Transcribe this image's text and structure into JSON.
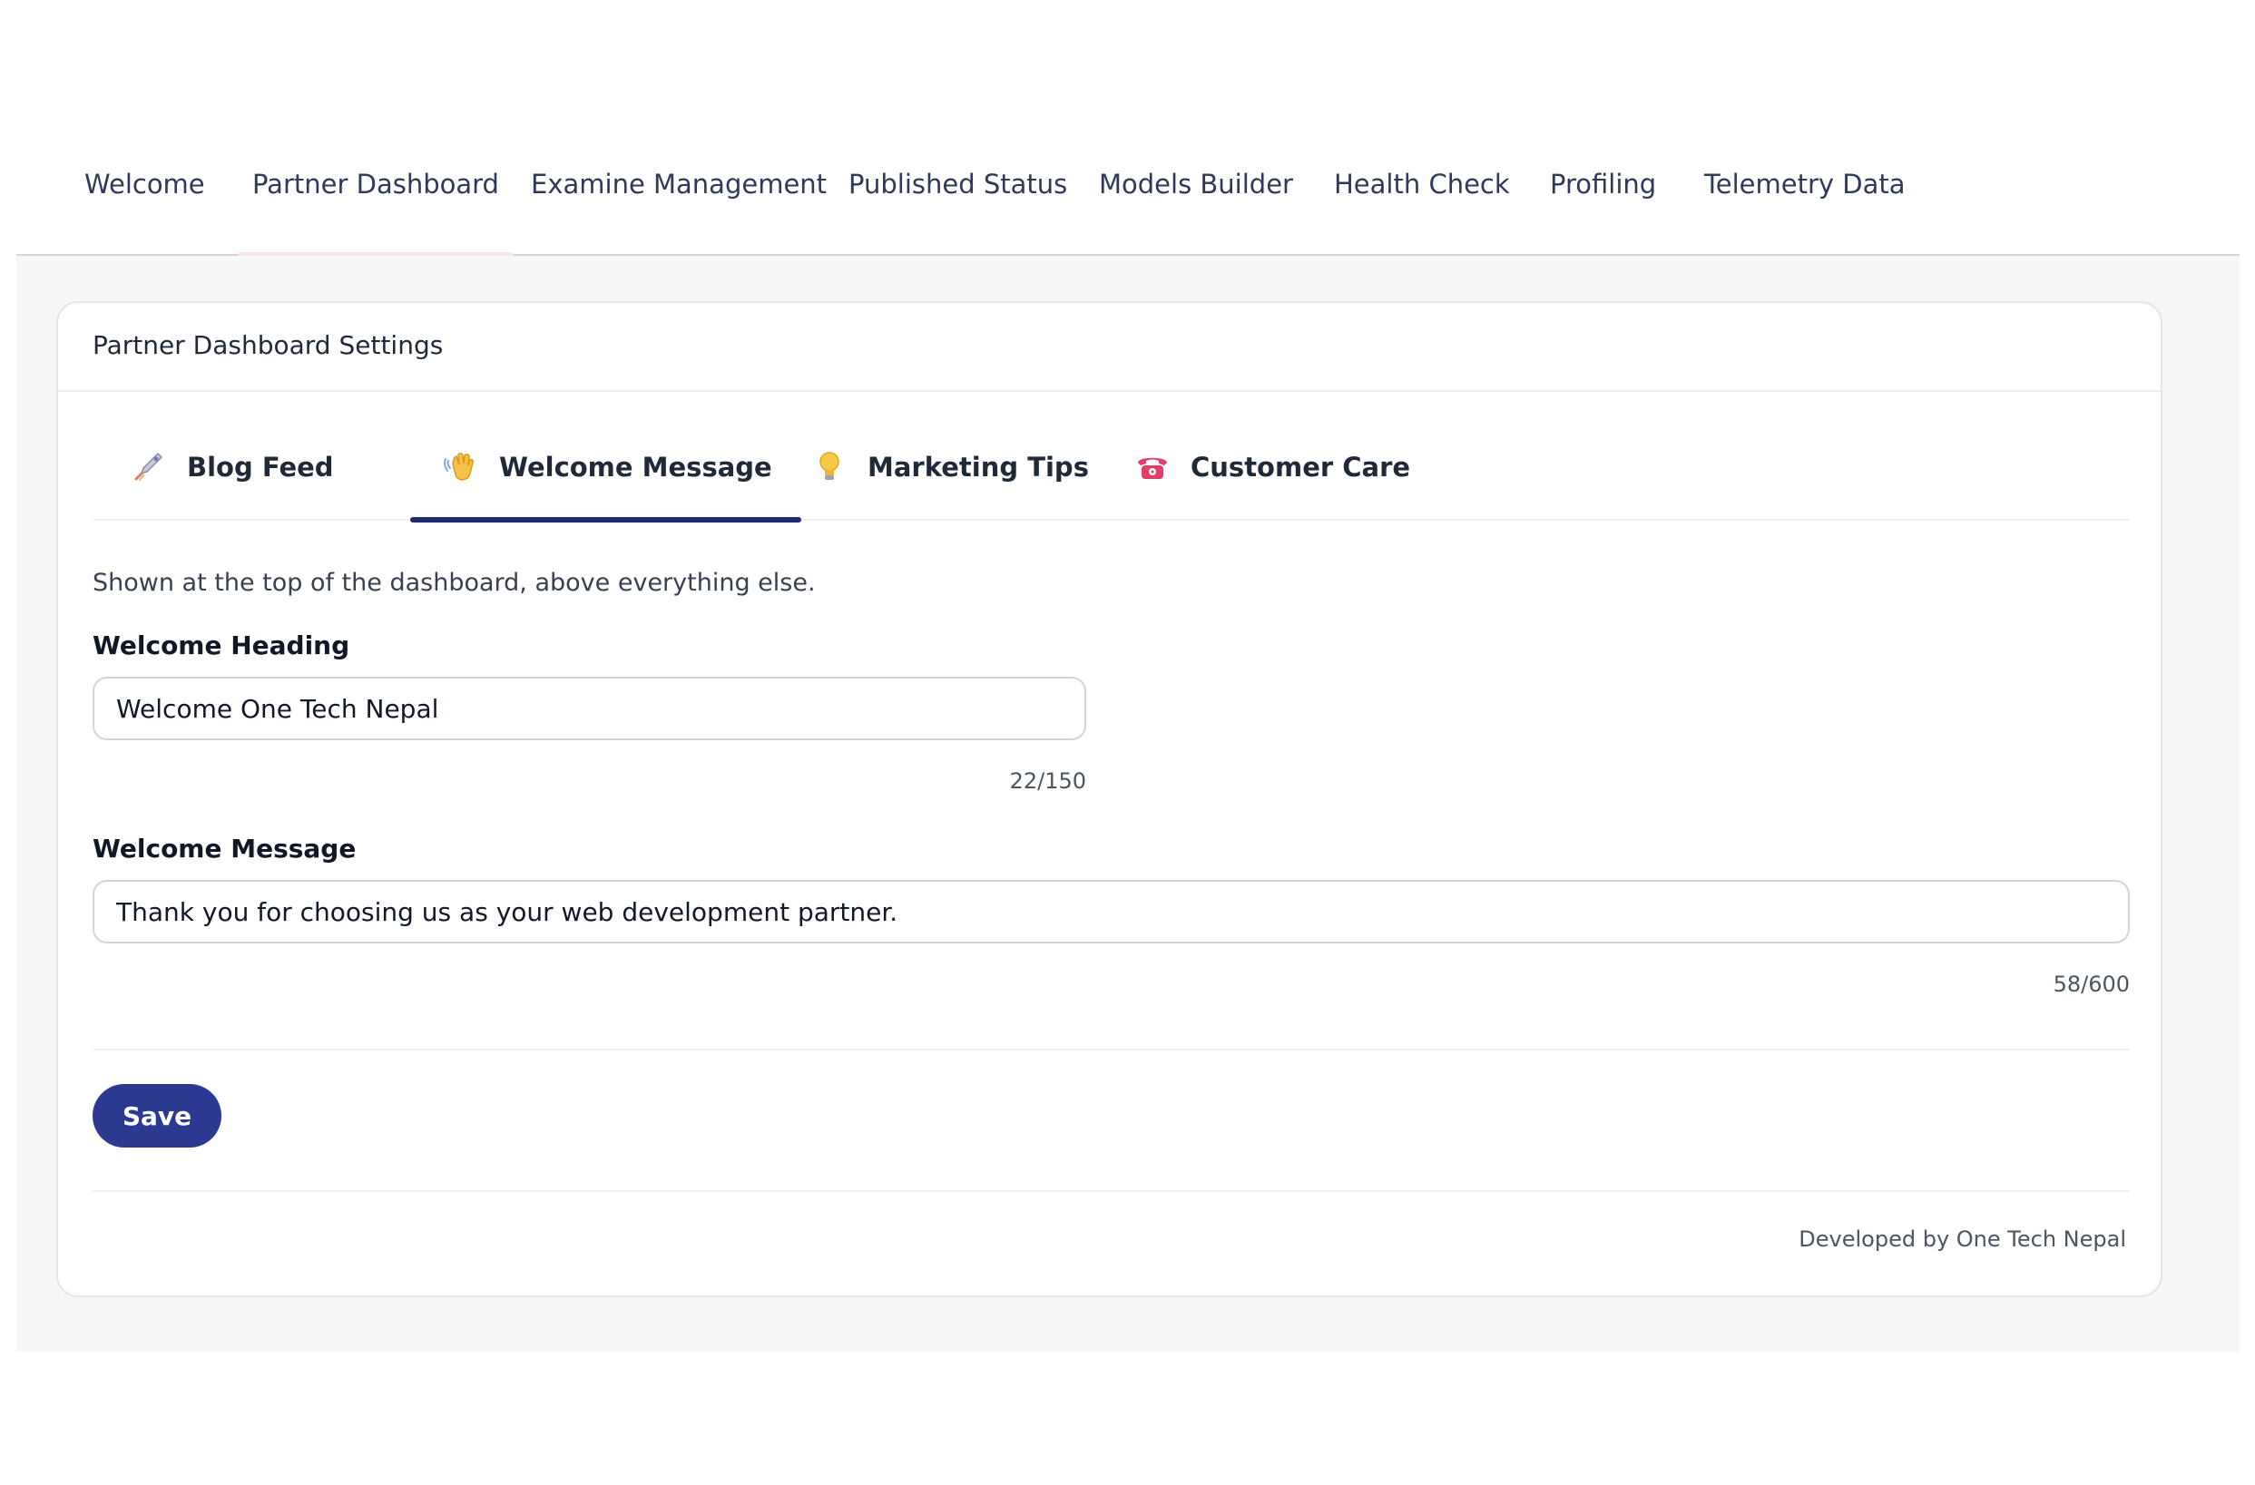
{
  "topnav": {
    "items": [
      {
        "label": "Welcome"
      },
      {
        "label": "Partner Dashboard",
        "active": true
      },
      {
        "label": "Examine Management"
      },
      {
        "label": "Published Status"
      },
      {
        "label": "Models Builder"
      },
      {
        "label": "Health Check"
      },
      {
        "label": "Profiling"
      },
      {
        "label": "Telemetry Data"
      }
    ]
  },
  "card": {
    "title": "Partner Dashboard Settings",
    "tabs": [
      {
        "label": "Blog Feed",
        "icon": "rocket-icon"
      },
      {
        "label": "Welcome Message",
        "icon": "waving-hand-icon",
        "active": true
      },
      {
        "label": "Marketing Tips",
        "icon": "lightbulb-icon"
      },
      {
        "label": "Customer Care",
        "icon": "telephone-icon"
      }
    ],
    "helper_text": "Shown at the top of the dashboard, above everything else.",
    "heading_field": {
      "label": "Welcome Heading",
      "value": "Welcome One Tech Nepal",
      "counter": "22/150"
    },
    "message_field": {
      "label": "Welcome Message",
      "value": "Thank you for choosing us as your web development partner.",
      "counter": "58/600"
    },
    "save_label": "Save",
    "footer_credit": "Developed by One Tech Nepal"
  },
  "colors": {
    "primary": "#2b3990",
    "active_tab_underline": "#1f2a6b",
    "nav_text": "#2f3a5a",
    "page_bg": "#f7f7f7"
  }
}
